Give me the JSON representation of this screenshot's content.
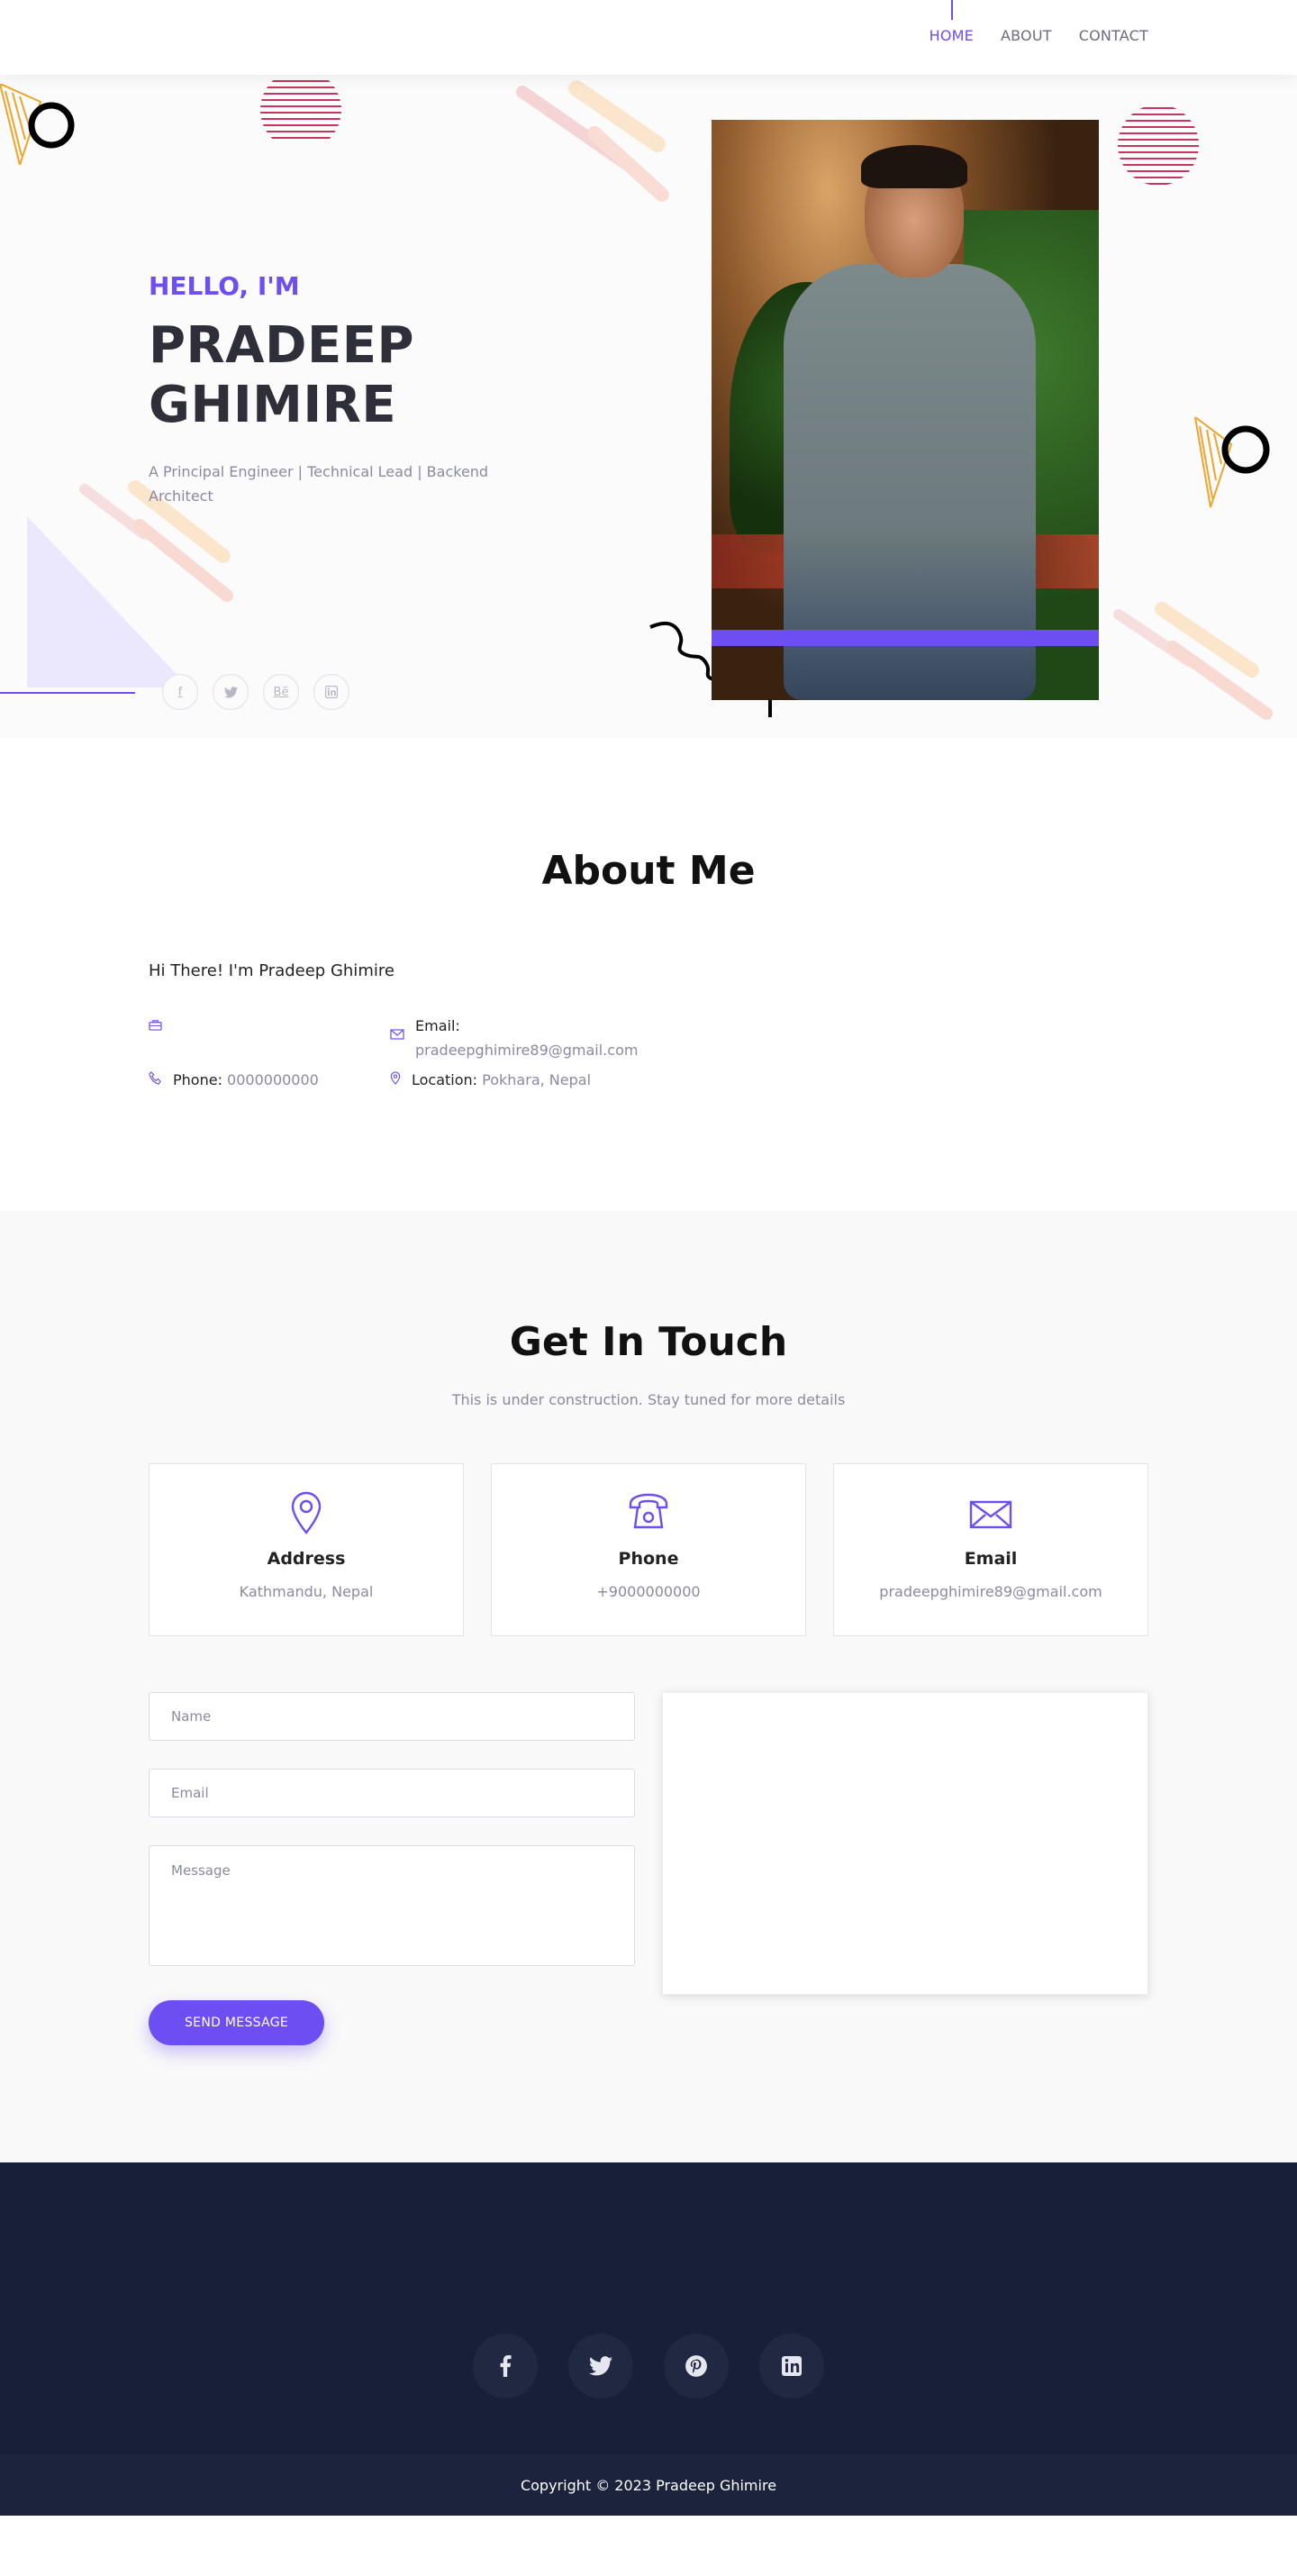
{
  "nav": {
    "items": [
      {
        "label": "HOME",
        "active": true
      },
      {
        "label": "ABOUT",
        "active": false
      },
      {
        "label": "CONTACT",
        "active": false
      }
    ]
  },
  "hero": {
    "greeting": "HELLO, I'M",
    "name_line1": "PRADEEP",
    "name_line2": "GHIMIRE",
    "tagline": "A Principal Engineer | Technical Lead | Backend Architect",
    "social": [
      "facebook-icon",
      "twitter-icon",
      "behance-icon",
      "linkedin-icon"
    ],
    "social_glyphs": {
      "facebook": "f",
      "twitter": "t",
      "behance": "Bē",
      "linkedin": "in"
    }
  },
  "about": {
    "title": "About Me",
    "subtitle": "Hi There! I'm Pradeep Ghimire",
    "email_label": "Email:",
    "email_value": "pradeepghimire89@gmail.com",
    "phone_label": "Phone:",
    "phone_value": "0000000000",
    "location_label": "Location:",
    "location_value": "Pokhara, Nepal"
  },
  "contact": {
    "title": "Get In Touch",
    "subtitle": "This is under construction. Stay tuned for more details",
    "cards": [
      {
        "title": "Address",
        "value": "Kathmandu, Nepal",
        "icon": "map-pin-icon"
      },
      {
        "title": "Phone",
        "value": "+9000000000",
        "icon": "telephone-icon"
      },
      {
        "title": "Email",
        "value": "pradeepghimire89@gmail.com",
        "icon": "envelope-icon"
      }
    ],
    "form": {
      "name_placeholder": "Name",
      "email_placeholder": "Email",
      "message_placeholder": "Message",
      "submit_label": "SEND MESSAGE"
    }
  },
  "footer": {
    "social": [
      "facebook-icon",
      "twitter-icon",
      "pinterest-icon",
      "linkedin-icon"
    ],
    "copyright": "Copyright © 2023 Pradeep Ghimire"
  },
  "colors": {
    "accent": "#6c4ef2",
    "footer_bg": "#181f38",
    "hero_bg": "#fbfbfb",
    "contact_bg": "#f9f9f9"
  }
}
